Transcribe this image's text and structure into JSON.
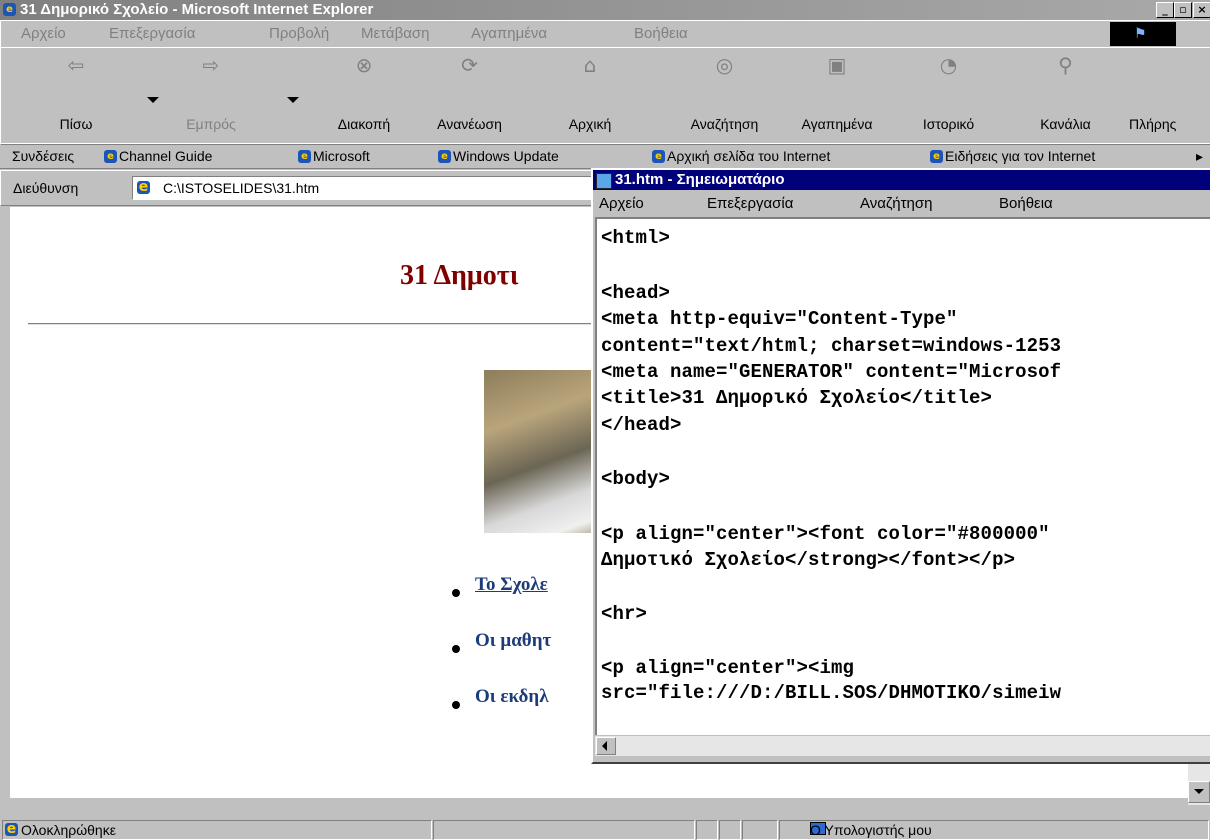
{
  "ie": {
    "title": "31 Δημορικό Σχολείο - Microsoft Internet Explorer",
    "menu": [
      "Αρχείο",
      "Επεξεργασία",
      "Προβολή",
      "Μετάβαση",
      "Αγαπημένα",
      "Βοήθεια"
    ],
    "toolbar": {
      "back": "Πίσω",
      "forward": "Εμπρός",
      "stop": "Διακοπή",
      "refresh": "Ανανέωση",
      "home": "Αρχική",
      "search": "Αναζήτηση",
      "favorites": "Αγαπημένα",
      "history": "Ιστορικό",
      "channels": "Κανάλια",
      "fullscreen": "Πλήρης"
    },
    "links": {
      "label": "Συνδέσεις",
      "items": [
        "Channel Guide",
        "Microsoft",
        "Windows Update",
        "Αρχική σελίδα του Internet",
        "Ειδήσεις για τον Internet"
      ],
      "more": "▸"
    },
    "address": {
      "label": "Διεύθυνση",
      "value": "C:\\ISTOSELIDES\\31.htm"
    },
    "page": {
      "heading": "31 Δημοτι",
      "links": [
        "Το Σχολε",
        "Οι μαθητ",
        "Οι εκδηλ"
      ]
    },
    "status": {
      "text": "Ολοκληρώθηκε",
      "zone": "Ο Υπολογιστής μου"
    }
  },
  "notepad": {
    "title": "31.htm - Σημειωματάριο",
    "menu": [
      "Αρχείο",
      "Επεξεργασία",
      "Αναζήτηση",
      "Βοήθεια"
    ],
    "lines": [
      "<html>",
      "",
      "<head>",
      "<meta http-equiv=\"Content-Type\"",
      "content=\"text/html; charset=windows-1253",
      "<meta name=\"GENERATOR\" content=\"Microsof",
      "<title>31 Δημορικό Σχολείο</title>",
      "</head>",
      "",
      "<body>",
      "",
      "<p align=\"center\"><font color=\"#800000\"",
      "Δημοτικό Σχολείο</strong></font></p>",
      "",
      "<hr>",
      "",
      "<p align=\"center\"><img",
      "src=\"file:///D:/BILL.SOS/DHMOTIKO/simeiw"
    ]
  },
  "colors": {
    "title_inactive": "#808080",
    "title_active": "#00007b",
    "heading": "#800000",
    "link": "#1b3c79"
  }
}
